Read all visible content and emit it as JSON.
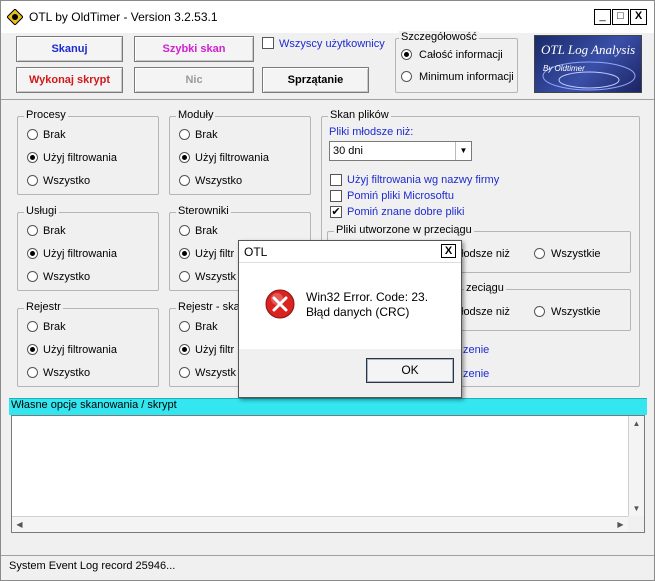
{
  "window": {
    "title": "OTL by OldTimer - Version 3.2.53.1",
    "controls": {
      "minimize": "_",
      "maximize": "□",
      "close": "X"
    }
  },
  "toolbar": {
    "scan": "Skanuj",
    "quick_scan": "Szybki skan",
    "run_script": "Wykonaj skrypt",
    "nothing": "Nic",
    "cleanup": "Sprzątanie",
    "all_users": "Wszyscy użytkownicy",
    "scan_color": "#1d2bd0",
    "quick_scan_color": "#d21fd2",
    "run_script_color": "#d11a1a"
  },
  "detail": {
    "legend": "Szczegółowość",
    "options": [
      "Całość informacji",
      "Minimum informacji"
    ],
    "selected": 0
  },
  "logo": {
    "line1": "OTL Log Analysis",
    "line2": "By Oldtimer"
  },
  "groups": {
    "procesy": {
      "legend": "Procesy",
      "options": [
        "Brak",
        "Użyj filtrowania",
        "Wszystko"
      ],
      "selected": 1
    },
    "moduly": {
      "legend": "Moduły",
      "options": [
        "Brak",
        "Użyj filtrowania",
        "Wszystko"
      ],
      "selected": 1
    },
    "uslugi": {
      "legend": "Usługi",
      "options": [
        "Brak",
        "Użyj filtrowania",
        "Wszystko"
      ],
      "selected": 1
    },
    "sterowniki": {
      "legend": "Sterowniki",
      "options": [
        "Brak",
        "Użyj filtr",
        "Wszystk"
      ],
      "selected": 1
    },
    "rejestr": {
      "legend": "Rejestr",
      "options": [
        "Brak",
        "Użyj filtrowania",
        "Wszystko"
      ],
      "selected": 1
    },
    "rejestr_ska": {
      "legend": "Rejestr - ska",
      "options": [
        "Brak",
        "Użyj filtr",
        "Wszystk"
      ],
      "selected": 1
    }
  },
  "file_scan": {
    "legend": "Skan plików",
    "younger_label": "Pliki młodsze niż:",
    "younger_value": "30 dni",
    "checks": [
      {
        "label": "Użyj filtrowania wg nazwy firmy",
        "checked": false
      },
      {
        "label": "Pomiń pliki Microsoftu",
        "checked": false
      },
      {
        "label": "Pomiń znane dobre pliki",
        "checked": true
      }
    ],
    "created_legend": "Pliki utworzone w przeciągu",
    "created_opt1": "łodsze niż",
    "created_opt2": "Wszystkie",
    "modified_legend": "zeciągu",
    "modified_opt1": "łodsze niż",
    "modified_opt2": "Wszystkie",
    "extra1": "zenie",
    "extra2": "zenie"
  },
  "custom": {
    "label": "Własne opcje skanowania / skrypt"
  },
  "status": {
    "text": "System Event Log record 25946..."
  },
  "dialog": {
    "title": "OTL",
    "close": "X",
    "line1": "Win32 Error.  Code: 23.",
    "line2": "Błąd danych (CRC)",
    "ok": "OK"
  }
}
